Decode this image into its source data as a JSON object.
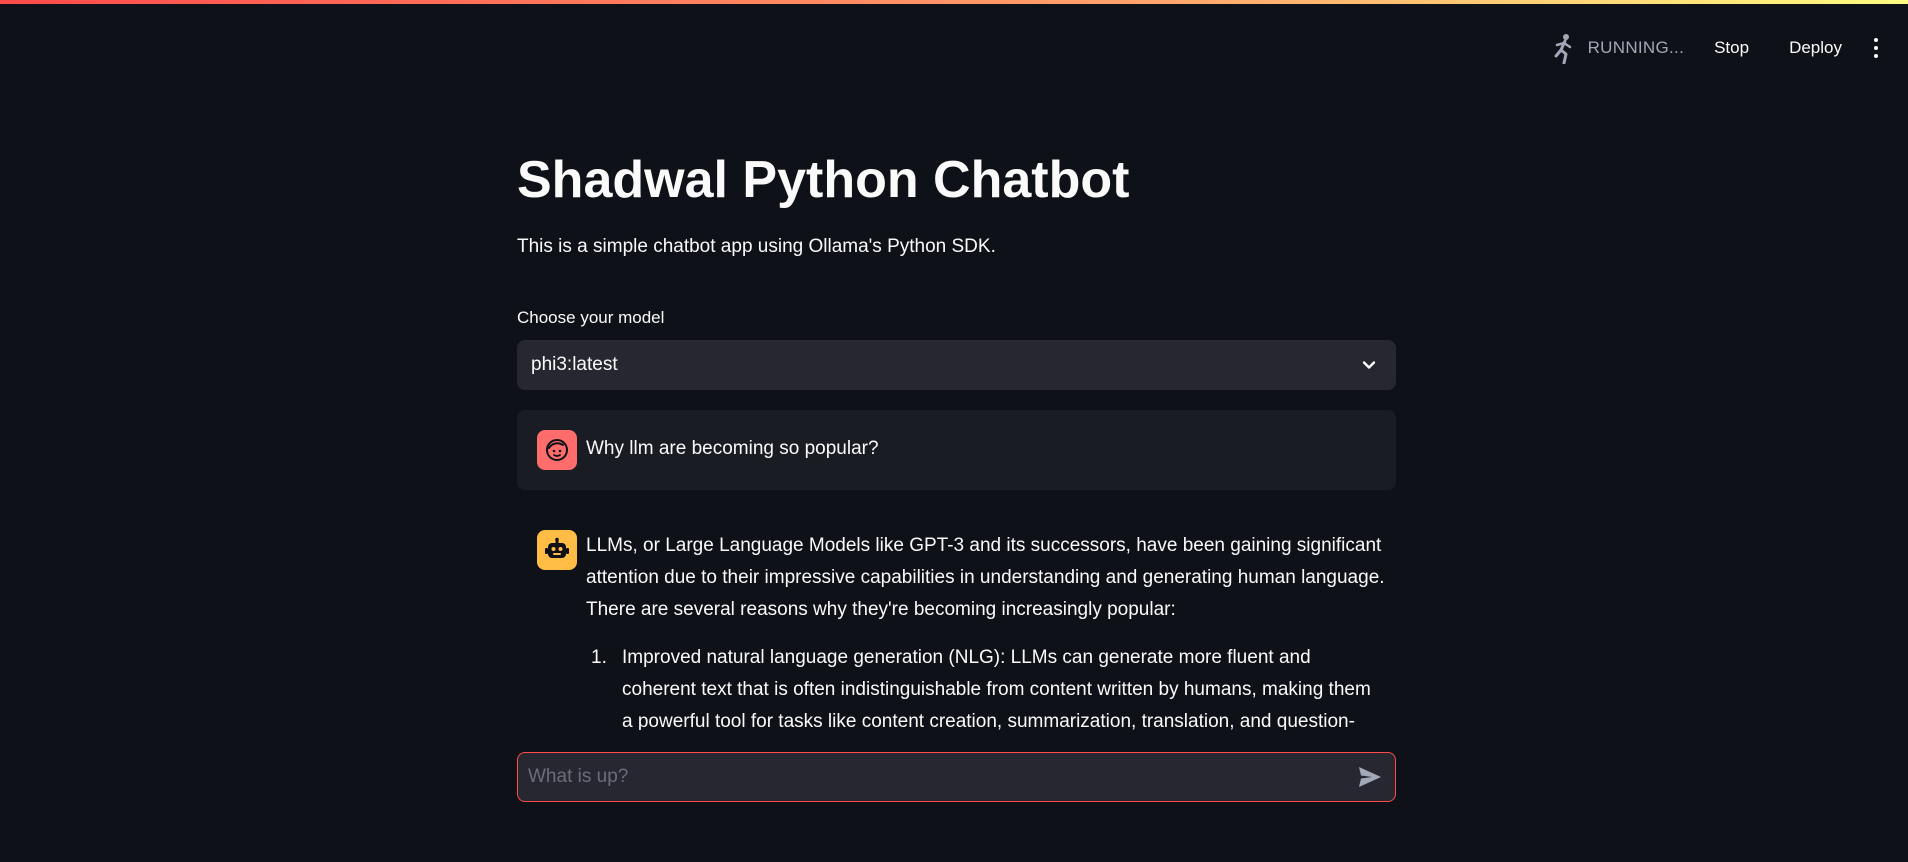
{
  "toolbar": {
    "status": "RUNNING...",
    "stop_label": "Stop",
    "deploy_label": "Deploy"
  },
  "main": {
    "title": "Shadwal Python Chatbot",
    "subtitle": "This is a simple chatbot app using Ollama's Python SDK.",
    "model_select": {
      "label": "Choose your model",
      "value": "phi3:latest"
    }
  },
  "messages": {
    "user": {
      "text": "Why llm are becoming so popular?"
    },
    "assistant": {
      "intro": "LLMs, or Large Language Models like GPT-3 and its successors, have been gaining significant attention due to their impressive capabilities in understanding and generating human language. There are several reasons why they're becoming increasingly popular:",
      "items": [
        {
          "number": "1.",
          "text": "Improved natural language generation (NLG): LLMs can generate more fluent and coherent text that is often indistinguishable from content written by humans, making them a powerful tool for tasks like content creation, summarization, translation, and question-"
        }
      ]
    }
  },
  "chat_input": {
    "placeholder": "What is up?"
  },
  "colors": {
    "background": "#0e1117",
    "surface": "#262730",
    "accent": "#ff4b4b",
    "user_avatar": "#ff6c6c",
    "bot_avatar": "#ffbd45"
  }
}
